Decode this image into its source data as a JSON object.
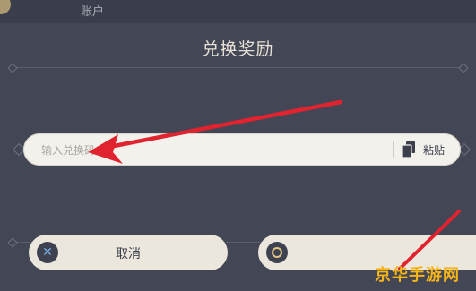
{
  "top_bar": {
    "tab_label": "账户"
  },
  "dialog": {
    "title": "兑换奖励",
    "code_input": {
      "placeholder": "输入兑换码",
      "paste_label": "粘贴"
    },
    "buttons": {
      "cancel_label": "取消",
      "confirm_label": ""
    }
  },
  "watermark": "京华手游网",
  "colors": {
    "arrow": "#e0232e",
    "accent_gold": "#e2c580",
    "cancel_icon": "#79aee3"
  },
  "icons": {
    "paste": "clipboard-icon",
    "cancel": "close-icon",
    "confirm": "circle-icon"
  }
}
